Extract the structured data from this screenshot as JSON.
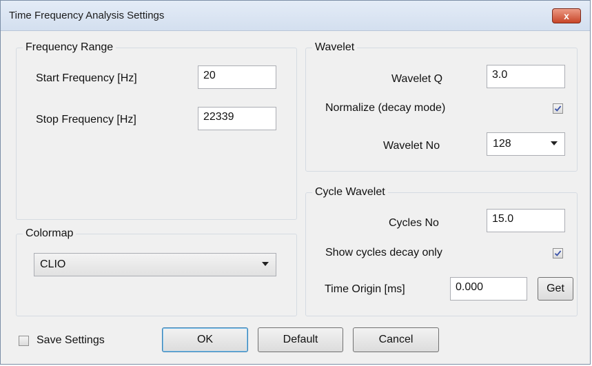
{
  "window": {
    "title": "Time Frequency Analysis Settings",
    "close_label": "x"
  },
  "frequency_range": {
    "legend": "Frequency Range",
    "start_label": "Start Frequency [Hz]",
    "start_value": "20",
    "stop_label": "Stop Frequency [Hz]",
    "stop_value": "22339"
  },
  "colormap": {
    "legend": "Colormap",
    "selected": "CLIO"
  },
  "wavelet": {
    "legend": "Wavelet",
    "q_label": "Wavelet Q",
    "q_value": "3.0",
    "normalize_label": "Normalize (decay mode)",
    "normalize_checked": true,
    "no_label": "Wavelet No",
    "no_selected": "128"
  },
  "cycle_wavelet": {
    "legend": "Cycle Wavelet",
    "cycles_label": "Cycles No",
    "cycles_value": "15.0",
    "decay_label": "Show cycles decay only",
    "decay_checked": true,
    "origin_label": "Time Origin [ms]",
    "origin_value": "0.000",
    "get_label": "Get"
  },
  "footer": {
    "save_label": "Save Settings",
    "save_checked": false,
    "ok_label": "OK",
    "default_label": "Default",
    "cancel_label": "Cancel"
  },
  "colors": {
    "close_button": "#c84528",
    "default_button_border": "#3c7fb1"
  }
}
